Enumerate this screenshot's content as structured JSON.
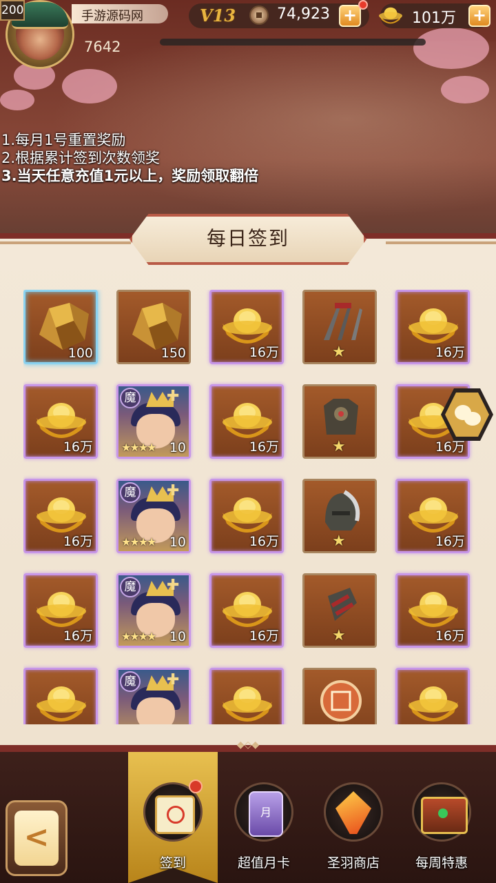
{
  "header": {
    "level": "200",
    "player_name": "手游源码网",
    "power": "7642",
    "vip": "V13",
    "copper": "74,923",
    "ingots": "101万"
  },
  "rules": [
    "1.每月1号重置奖励",
    "2.根据累计签到次数领奖",
    "3.当天任意充值1元以上，奖励领取翻倍"
  ],
  "panel": {
    "title": "每日签到"
  },
  "rewards": [
    {
      "type": "rock",
      "amount": "100",
      "frame": "blue"
    },
    {
      "type": "rock",
      "amount": "150",
      "frame": "brown"
    },
    {
      "type": "ingot",
      "amount": "16万",
      "frame": "purple"
    },
    {
      "type": "claw",
      "amount": "",
      "frame": "brown"
    },
    {
      "type": "ingot",
      "amount": "16万",
      "frame": "purple"
    },
    {
      "type": "ingot",
      "amount": "16万",
      "frame": "purple"
    },
    {
      "type": "hero",
      "amount": "10",
      "frame": "purple",
      "badge": "魔"
    },
    {
      "type": "ingot",
      "amount": "16万",
      "frame": "purple"
    },
    {
      "type": "armor",
      "amount": "",
      "frame": "brown"
    },
    {
      "type": "ingot",
      "amount": "16万",
      "frame": "purple"
    },
    {
      "type": "ingot",
      "amount": "16万",
      "frame": "purple"
    },
    {
      "type": "hero",
      "amount": "10",
      "frame": "purple",
      "badge": "魔"
    },
    {
      "type": "ingot",
      "amount": "16万",
      "frame": "purple"
    },
    {
      "type": "helmet",
      "amount": "",
      "frame": "brown"
    },
    {
      "type": "ingot",
      "amount": "16万",
      "frame": "purple"
    },
    {
      "type": "ingot",
      "amount": "16万",
      "frame": "purple"
    },
    {
      "type": "hero",
      "amount": "10",
      "frame": "purple",
      "badge": "魔"
    },
    {
      "type": "ingot",
      "amount": "16万",
      "frame": "purple"
    },
    {
      "type": "bracer",
      "amount": "",
      "frame": "brown"
    },
    {
      "type": "ingot",
      "amount": "16万",
      "frame": "purple"
    },
    {
      "type": "ingot",
      "amount": "",
      "frame": "purple"
    },
    {
      "type": "hero",
      "amount": "",
      "frame": "purple",
      "badge": "魔"
    },
    {
      "type": "ingot",
      "amount": "",
      "frame": "purple"
    },
    {
      "type": "token",
      "amount": "",
      "frame": "brown"
    },
    {
      "type": "ingot",
      "amount": "",
      "frame": "purple"
    }
  ],
  "nav": [
    {
      "label": "签到",
      "icon": "scroll-icon",
      "active": true
    },
    {
      "label": "超值月卡",
      "icon": "month-card-icon",
      "active": false
    },
    {
      "label": "圣羽商店",
      "icon": "feather-icon",
      "active": false
    },
    {
      "label": "每周特惠",
      "icon": "chest-icon",
      "active": false
    }
  ],
  "colors": {
    "panel_border": "#7e2e28",
    "gold": "#e9b540",
    "purple_frame": "#c796e8",
    "blue_frame": "#8ad2f0"
  }
}
